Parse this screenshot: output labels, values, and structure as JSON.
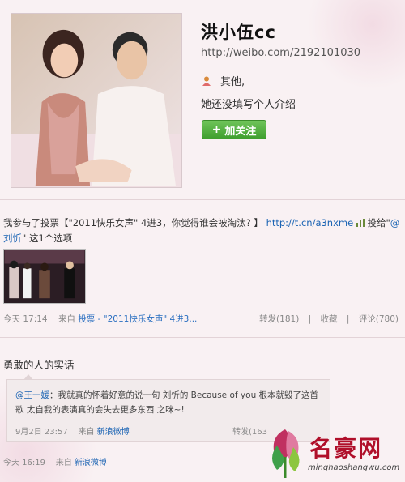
{
  "profile": {
    "name": "洪小伍cc",
    "url": "http://weibo.com/2192101030",
    "gender_text": "其他,",
    "intro": "她还没填写个人介绍",
    "follow_label": "加关注",
    "follow_plus": "+"
  },
  "post1": {
    "text_a": "我参与了投票【\"2011快乐女声\" 4进3，你觉得谁会被淘汰? 】",
    "link_url": "http://t.cn/a3nxme",
    "text_b": " 投给\"",
    "mention": "@刘忻",
    "text_c": "\" 这1个选项",
    "time": "今天 17:14",
    "source_prefix": "来自",
    "source": "投票 - \"2011快乐女声\" 4进3...",
    "forward": "转发(181)",
    "favorite": "收藏",
    "comment": "评论(780)",
    "divider": "|"
  },
  "post2": {
    "title": "勇敢的人的实话",
    "repost_user": "@王一媛",
    "repost_text": "：我就真的怀着好意的说一句 刘忻的 Because of you 根本就毁了这首歌 太自我的表演真的会失去更多东西 之咪~!",
    "repost_time": "9月2日 23:57",
    "repost_source_prefix": "来自",
    "repost_source": "新浪微博",
    "repost_forward": "转发(163",
    "time": "今天 16:19",
    "source_prefix": "来自",
    "source": "新浪微博"
  },
  "watermark": {
    "title": "名豪网",
    "url": "minghaoshangwu.com"
  },
  "icons": {
    "gender": "person-icon",
    "vote": "vote-icon",
    "logo": "flower-logo"
  },
  "colors": {
    "follow_button": "#4caf3a",
    "link": "#1a63b3",
    "watermark_red": "#b00f2a"
  }
}
